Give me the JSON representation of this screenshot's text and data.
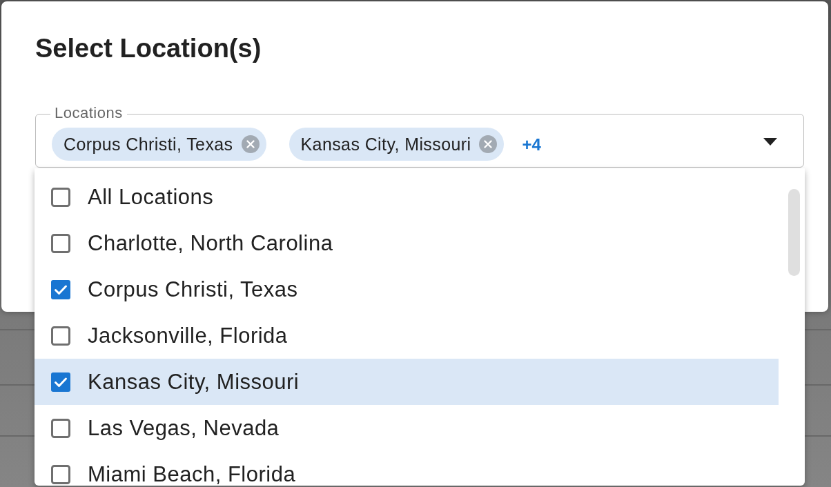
{
  "dialog": {
    "title": "Select Location(s)"
  },
  "field": {
    "label": "Locations",
    "chips": [
      {
        "label": "Corpus Christi, Texas"
      },
      {
        "label": "Kansas City, Missouri"
      }
    ],
    "more_count": "+4"
  },
  "options": [
    {
      "label": "All Locations",
      "checked": false,
      "highlighted": false
    },
    {
      "label": "Charlotte, North Carolina",
      "checked": false,
      "highlighted": false
    },
    {
      "label": "Corpus Christi, Texas",
      "checked": true,
      "highlighted": false
    },
    {
      "label": "Jacksonville, Florida",
      "checked": false,
      "highlighted": false
    },
    {
      "label": "Kansas City, Missouri",
      "checked": true,
      "highlighted": true
    },
    {
      "label": "Las Vegas, Nevada",
      "checked": false,
      "highlighted": false
    },
    {
      "label": "Miami Beach, Florida",
      "checked": false,
      "highlighted": false
    }
  ]
}
